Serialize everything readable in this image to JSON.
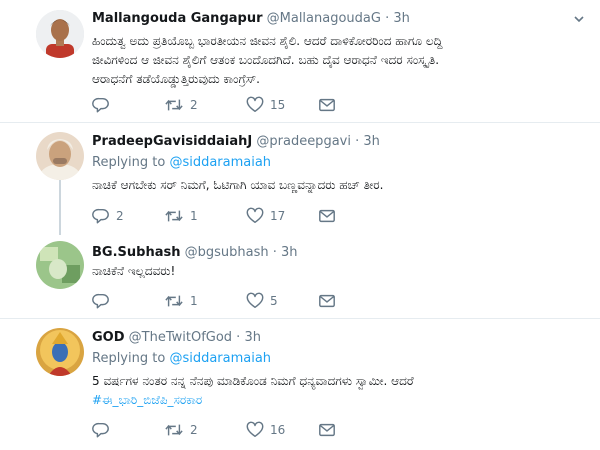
{
  "tweets": [
    {
      "name": "Mallangouda Gangapur",
      "handle": "@MallanagoudaG · 3h",
      "replying_prefix": "",
      "replying_to": "",
      "text_lines": [
        "ಹಿಂದುತ್ವ ಅದು ಪ್ರತಿಯೊಬ್ಬ ಭಾರತೀಯನ ಜೀವನ ಶೈಲಿ. ಆದರೆ ದಾಳಿಕೋರರಿಂದ ಹಾಗೂ ಲದ್ದಿ",
        "ಜೀವಿಗಳಿಂದ ಆ ಜೀವನ ಶೈಲಿಗೆ ಆತಂಕ ಬಂದೊದಗಿದೆ. ಬಹು ದೈವ ಆರಾಧನೆ ಇದರ ಸಂಸ್ಕೃತಿ.",
        "ಆರಾಧನೆಗೆ ತಡೆಯೊಡ್ಡುತ್ತಿರುವುದು ಕಾಂಗ್ರೆಸ್."
      ],
      "hashtag": "",
      "replies": "",
      "retweets": "2",
      "likes": "15"
    },
    {
      "name": "PradeepGavisiddaiahJ",
      "handle": "@pradeepgavi · 3h",
      "replying_prefix": "Replying to ",
      "replying_to": "@siddaramaiah",
      "text_lines": [
        "ನಾಚಿಕೆ ಆಗಬೇಕು ಸರ್ ನಿಮಗೆ, ಓಟಿಗಾಗಿ ಯಾವ ಬಣ್ಣವನ್ನಾದರು ಹಚ್ ತೀರ."
      ],
      "hashtag": "",
      "replies": "2",
      "retweets": "1",
      "likes": "17"
    },
    {
      "name": "BG.Subhash",
      "handle": "@bgsubhash · 3h",
      "replying_prefix": "",
      "replying_to": "",
      "text_lines": [
        "ನಾಚಿಕೆನೆ ಇಲ್ಲದವರು!"
      ],
      "hashtag": "",
      "replies": "",
      "retweets": "1",
      "likes": "5"
    },
    {
      "name": "GOD",
      "handle": "@TheTwitOfGod · 3h",
      "replying_prefix": "Replying to ",
      "replying_to": "@siddaramaiah",
      "text_lines": [
        "5 ವರ್ಷಗಳ ನಂತರ ನನ್ನ ನೆನಪು ಮಾಡಿಕೊಂಡ ನಿಮಗೆ ಧನ್ಯವಾದಗಳು ಸ್ವಾಮೀ. ಆದರೆ"
      ],
      "hashtag": "#ಈ_ಭಾರಿ_ಬಿಜೆಪಿ_ಸರಕಾರ",
      "replies": "",
      "retweets": "2",
      "likes": "16"
    }
  ],
  "colors": {
    "accent": "#1da1f2",
    "muted": "#657786",
    "separator": "#e6ecf0",
    "thread_line": "#ccd6dd"
  },
  "icons": [
    "reply-icon",
    "retweet-icon",
    "like-icon",
    "direct-message-icon",
    "caret-down-icon"
  ]
}
